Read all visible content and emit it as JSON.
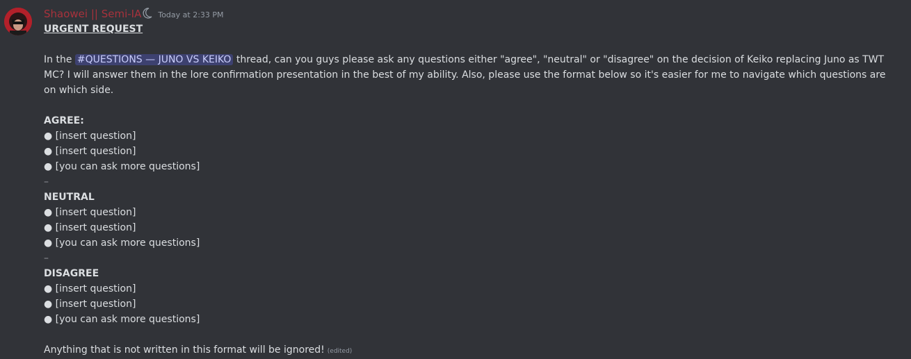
{
  "author": {
    "name": "Shaowei || Semi-IA",
    "timestamp": "Today at 2:33 PM"
  },
  "message": {
    "title": "URGENT REQUEST",
    "intro_before": "In the ",
    "channel_mention": "#QUESTIONS — JUNO VS KEIKO",
    "intro_after": " thread, can you guys please ask any questions either \"agree\", \"neutral\" or \"disagree\" on the decision of Keiko replacing Juno as TWT MC? I will answer them in the lore confirmation presentation in the best of my ability. Also, please use the format below so it's easier for me to navigate which questions are on which side.",
    "sections": [
      {
        "heading": "AGREE:",
        "items": [
          "● [insert question]",
          "● [insert question]",
          "● [you can ask more questions]"
        ],
        "separator": "–"
      },
      {
        "heading": "NEUTRAL",
        "items": [
          "● [insert question]",
          "● [insert question]",
          "● [you can ask more questions]"
        ],
        "separator": "–"
      },
      {
        "heading": "DISAGREE",
        "items": [
          "● [insert question]",
          "● [insert question]",
          "● [you can ask more questions]"
        ]
      }
    ],
    "footer": "Anything that is not written in this format will be ignored!",
    "edited": "(edited)"
  },
  "colors": {
    "background": "#313338",
    "username": "#a8323c",
    "mention_bg": "#3c4270",
    "text": "#dbdee1"
  },
  "icons": [
    "avatar",
    "crescent-moon-icon"
  ]
}
